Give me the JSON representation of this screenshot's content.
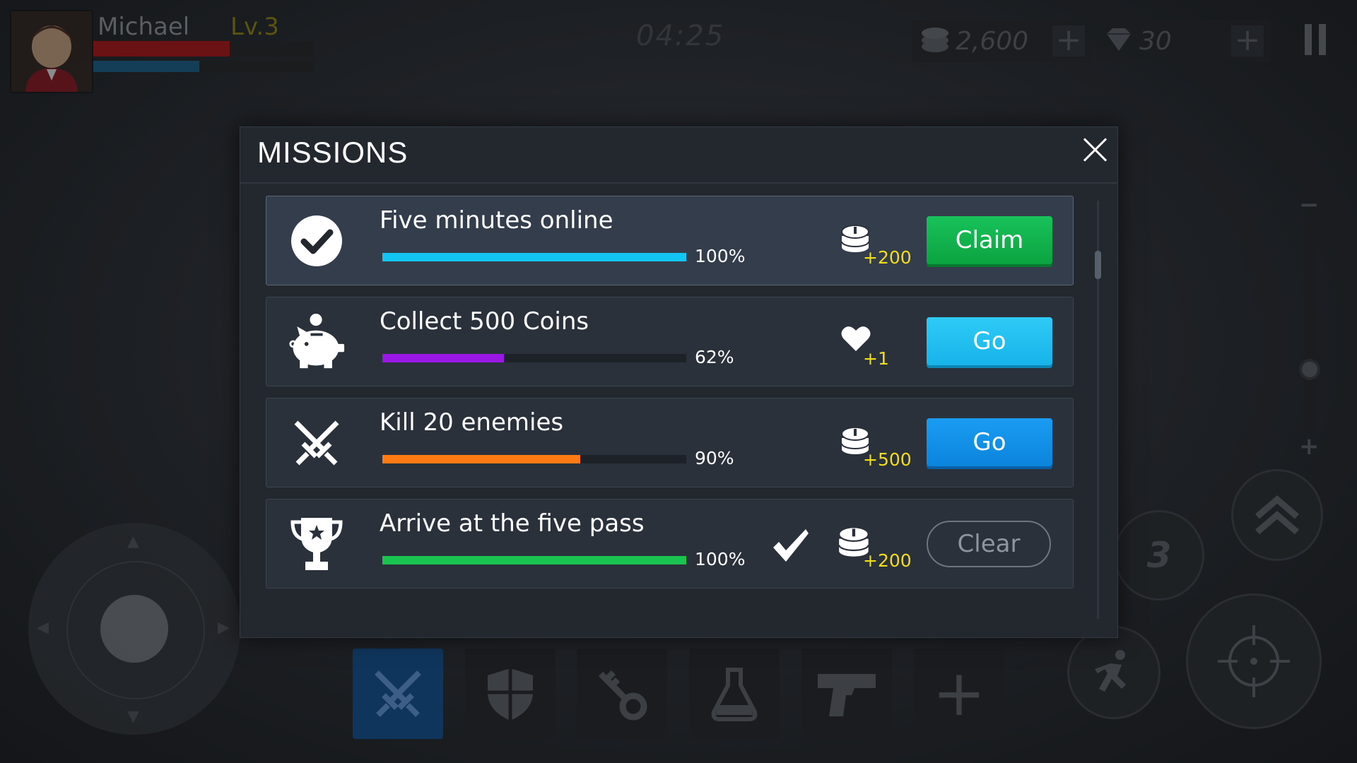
{
  "hud": {
    "player_name": "Michael",
    "player_level": "Lv.3",
    "hp_fraction": 0.62,
    "mp_fraction": 0.48,
    "timer": "04:25",
    "coins": "2,600",
    "gems": "30",
    "ability_cooldown": "3",
    "colors": {
      "hp": "#6b1214",
      "mp": "#143e58"
    }
  },
  "toolbar": {
    "slots": [
      {
        "icon": "crossed-swords-icon",
        "active": true
      },
      {
        "icon": "shield-icon",
        "active": false
      },
      {
        "icon": "key-icon",
        "active": false
      },
      {
        "icon": "potion-icon",
        "active": false
      },
      {
        "icon": "pistol-icon",
        "active": false
      },
      {
        "icon": "plus-icon",
        "active": false
      }
    ]
  },
  "modal": {
    "title": "MISSIONS",
    "missions": [
      {
        "icon": "check-circle-icon",
        "title": "Five minutes online",
        "progress": 1.0,
        "percent_label": "100%",
        "bar_color": "#12c5f2",
        "reward_icon": "coins-icon",
        "reward_amount": "+200",
        "button": "Claim",
        "completed_mark": false,
        "highlight": true
      },
      {
        "icon": "piggy-bank-icon",
        "title": "Collect 500 Coins",
        "progress": 0.4,
        "percent_label": "62%",
        "bar_color": "#9b17e6",
        "reward_icon": "heart-icon",
        "reward_amount": "+1",
        "button": "Go",
        "completed_mark": false,
        "highlight": false
      },
      {
        "icon": "crossed-swords-icon",
        "title": "Kill 20 enemies",
        "progress": 0.65,
        "percent_label": "90%",
        "bar_color": "#ff7a12",
        "reward_icon": "coins-icon",
        "reward_amount": "+500",
        "button": "Go",
        "completed_mark": false,
        "highlight": false
      },
      {
        "icon": "trophy-icon",
        "title": "Arrive at the five pass",
        "progress": 1.0,
        "percent_label": "100%",
        "bar_color": "#1ac24f",
        "reward_icon": "coins-icon",
        "reward_amount": "+200",
        "button": "Clear",
        "completed_mark": true,
        "highlight": false
      }
    ]
  }
}
